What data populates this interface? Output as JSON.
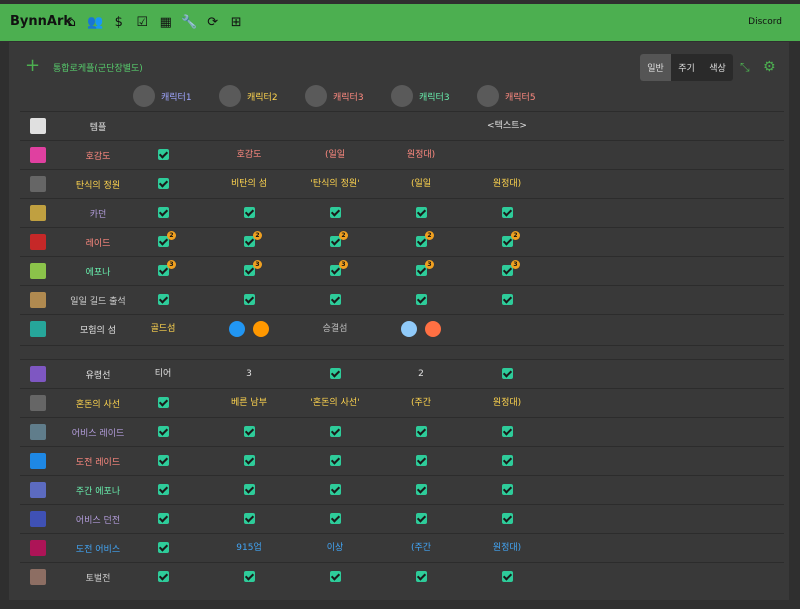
{
  "app": {
    "brand": "BynnArk",
    "discord": "Discord"
  },
  "nav_icons": [
    "home-icon",
    "users-icon",
    "dollar-icon",
    "checkbox-icon",
    "calendar-icon",
    "wrench-icon",
    "sync-icon",
    "plus-square-icon"
  ],
  "header": {
    "add": "+",
    "title": "통합로케플(군단장별도)",
    "tabs": [
      "일반",
      "주기",
      "색상"
    ],
    "active_tab": "일반"
  },
  "characters": [
    {
      "name": "캐릭터1",
      "color": "#9fa6ff"
    },
    {
      "name": "캐릭터2",
      "color": "#ffd54f"
    },
    {
      "name": "캐릭터3",
      "color": "#ff8a80"
    },
    {
      "name": "캐릭터3",
      "color": "#69f0ae"
    },
    {
      "name": "캐릭터5",
      "color": "#ff8a80"
    }
  ],
  "rows_top": [
    {
      "label": "템플",
      "label_color": "#e0e0e0",
      "icon_color": "#e0e0e0",
      "cells": [
        "",
        "",
        "",
        "",
        "<텍스트>"
      ]
    },
    {
      "label": "호감도",
      "label_color": "#ff8a80",
      "icon_color": "#e040a0",
      "cells": [
        "✓",
        "호감도",
        "(일일",
        "원정대)",
        ""
      ]
    },
    {
      "label": "탄식의 정원",
      "label_color": "#ffd54f",
      "icon_color": "#666",
      "cells": [
        "✓",
        "비탄의 섬",
        "'탄식의 정원'",
        "(일일",
        "원정대)"
      ]
    },
    {
      "label": "카던",
      "label_color": "#b39ddb",
      "icon_color": "#c0a040",
      "cells": [
        "✓",
        "✓",
        "✓",
        "✓",
        "✓"
      ]
    },
    {
      "label": "레이드",
      "label_color": "#ff8a80",
      "icon_color": "#c62828",
      "cells": [
        "✓2",
        "✓2",
        "✓2",
        "✓2",
        "✓2"
      ]
    },
    {
      "label": "에포나",
      "label_color": "#69f0ae",
      "icon_color": "#8bc34a",
      "cells": [
        "✓3",
        "✓3",
        "✓3",
        "✓3",
        "✓3"
      ]
    },
    {
      "label": "일일 길드 출석",
      "label_color": "#cfcfcf",
      "icon_color": "#b08a50",
      "cells": [
        "✓",
        "✓",
        "✓",
        "✓",
        "✓"
      ]
    },
    {
      "label": "모험의 섬",
      "label_color": "#e0e0e0",
      "icon_color": "#26a69a",
      "cells": [
        "골드섬",
        "ISL",
        "승결섬",
        "ISL2",
        ""
      ]
    }
  ],
  "rows_bottom": [
    {
      "label": "유령선",
      "label_color": "#e0e0e0",
      "icon_color": "#7e57c2",
      "cells": [
        "티어",
        "3",
        "✓",
        "2",
        "✓"
      ]
    },
    {
      "label": "혼돈의 사선",
      "label_color": "#ffd54f",
      "icon_color": "#666",
      "cells": [
        "✓",
        "베른 남부",
        "'혼돈의 사선'",
        "(주간",
        "원정대)"
      ]
    },
    {
      "label": "어비스 레이드",
      "label_color": "#b39ddb",
      "icon_color": "#607d8b",
      "cells": [
        "✓",
        "✓",
        "✓",
        "✓",
        "✓"
      ]
    },
    {
      "label": "도전 레이드",
      "label_color": "#ff8a80",
      "icon_color": "#1e88e5",
      "cells": [
        "✓",
        "✓",
        "✓",
        "✓",
        "✓"
      ]
    },
    {
      "label": "주간 에포나",
      "label_color": "#69f0ae",
      "icon_color": "#5c6bc0",
      "cells": [
        "✓",
        "✓",
        "✓",
        "✓",
        "✓"
      ]
    },
    {
      "label": "어비스 던전",
      "label_color": "#b39ddb",
      "icon_color": "#3f51b5",
      "cells": [
        "✓",
        "✓",
        "✓",
        "✓",
        "✓"
      ]
    },
    {
      "label": "도전 어비스",
      "label_color": "#42a5f5",
      "icon_color": "#ad1457",
      "cells": [
        "✓",
        "915업",
        "이상",
        "(주간",
        "원정대)"
      ]
    },
    {
      "label": "토벌전",
      "label_color": "#cfcfcf",
      "icon_color": "#8d6e63",
      "cells": [
        "✓",
        "✓",
        "✓",
        "✓",
        "✓"
      ]
    }
  ],
  "text_colors": {
    "default": "#e0e0e0",
    "yellow": "#ffd54f",
    "pink": "#ff8a80",
    "blue": "#42a5f5",
    "gray": "#bdbdbd"
  }
}
